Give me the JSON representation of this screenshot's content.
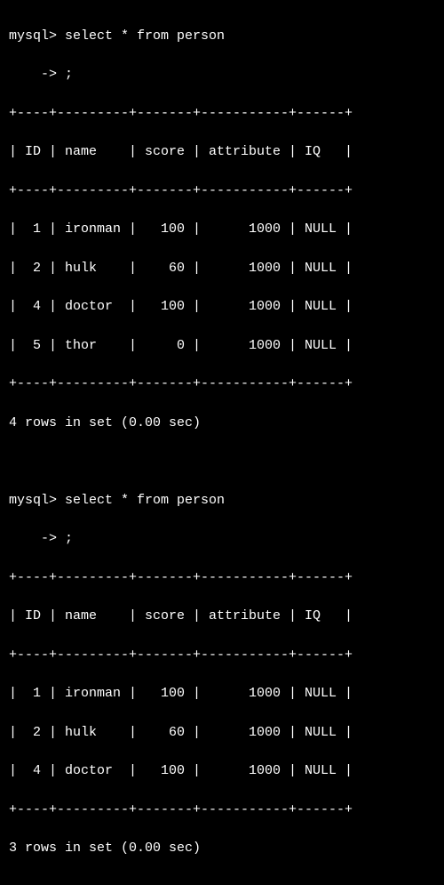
{
  "query1": {
    "prompt": "mysql>",
    "sql": "select * from person",
    "cont_prompt": "    ->",
    "terminator": ";",
    "border": "+----+---------+-------+-----------+------+",
    "header": "| ID | name    | score | attribute | IQ   |",
    "columns": [
      "ID",
      "name",
      "score",
      "attribute",
      "IQ"
    ],
    "rows": [
      {
        "ID": 1,
        "name": "ironman",
        "score": 100,
        "attribute": 1000,
        "IQ": "NULL",
        "text": "|  1 | ironman |   100 |      1000 | NULL |"
      },
      {
        "ID": 2,
        "name": "hulk",
        "score": 60,
        "attribute": 1000,
        "IQ": "NULL",
        "text": "|  2 | hulk    |    60 |      1000 | NULL |"
      },
      {
        "ID": 4,
        "name": "doctor",
        "score": 100,
        "attribute": 1000,
        "IQ": "NULL",
        "text": "|  4 | doctor  |   100 |      1000 | NULL |"
      },
      {
        "ID": 5,
        "name": "thor",
        "score": 0,
        "attribute": 1000,
        "IQ": "NULL",
        "text": "|  5 | thor    |     0 |      1000 | NULL |"
      }
    ],
    "status": "4 rows in set (0.00 sec)",
    "row_count": 4,
    "elapsed_sec": 0.0
  },
  "query2": {
    "prompt": "mysql>",
    "sql": "select * from person",
    "cont_prompt": "    ->",
    "terminator": ";",
    "border": "+----+---------+-------+-----------+------+",
    "header": "| ID | name    | score | attribute | IQ   |",
    "columns": [
      "ID",
      "name",
      "score",
      "attribute",
      "IQ"
    ],
    "rows": [
      {
        "ID": 1,
        "name": "ironman",
        "score": 100,
        "attribute": 1000,
        "IQ": "NULL",
        "text": "|  1 | ironman |   100 |      1000 | NULL |"
      },
      {
        "ID": 2,
        "name": "hulk",
        "score": 60,
        "attribute": 1000,
        "IQ": "NULL",
        "text": "|  2 | hulk    |    60 |      1000 | NULL |"
      },
      {
        "ID": 4,
        "name": "doctor",
        "score": 100,
        "attribute": 1000,
        "IQ": "NULL",
        "text": "|  4 | doctor  |   100 |      1000 | NULL |"
      }
    ],
    "status": "3 rows in set (0.00 sec)",
    "row_count": 3,
    "elapsed_sec": 0.0
  }
}
